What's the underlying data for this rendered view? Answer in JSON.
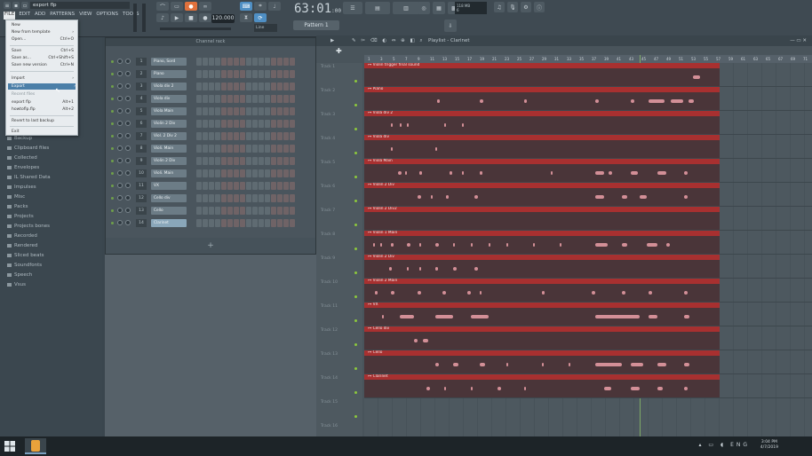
{
  "app": {
    "title_field": "export flp",
    "menu": [
      "FILE",
      "EDIT",
      "ADD",
      "PATTERNS",
      "VIEW",
      "OPTIONS",
      "TOOLS",
      "?"
    ],
    "tempo": "120.000",
    "time": "63:01",
    "time_sub": ":00",
    "pattern": "Pattern 1",
    "cpu_line1": "118 MB",
    "cpu_line2": "6"
  },
  "file_menu": {
    "items": [
      {
        "label": "New",
        "shortcut": ""
      },
      {
        "label": "New from template",
        "shortcut": "›"
      },
      {
        "label": "Open...",
        "shortcut": "Ctrl+O"
      },
      {
        "label": "Save",
        "shortcut": "Ctrl+S"
      },
      {
        "label": "Save as...",
        "shortcut": "Ctrl+Shift+S"
      },
      {
        "label": "Save new version",
        "shortcut": "Ctrl+N"
      },
      {
        "label": "Import",
        "shortcut": "›"
      },
      {
        "label": "Export",
        "shortcut": "›"
      },
      {
        "label": "Recent files",
        "shortcut": ""
      },
      {
        "label": "export flp",
        "shortcut": "Alt+1"
      },
      {
        "label": "howtoflp.flp",
        "shortcut": "Alt+2"
      },
      {
        "label": "Revert to last backup",
        "shortcut": ""
      },
      {
        "label": "Exit",
        "shortcut": ""
      }
    ]
  },
  "browser": {
    "items": [
      "Backup",
      "Clipboard files",
      "Collected",
      "Envelopes",
      "IL Shared Data",
      "Impulses",
      "Misc",
      "Packs",
      "Projects",
      "Projects bones",
      "Recorded",
      "Rendered",
      "Sliced beats",
      "Soundfonts",
      "Speech",
      "Vsus"
    ]
  },
  "channel_rack": {
    "title": "Channel rack",
    "channels": [
      {
        "num": "1",
        "name": "Piano, Sord"
      },
      {
        "num": "2",
        "name": "Piano"
      },
      {
        "num": "3",
        "name": "Viola div 2"
      },
      {
        "num": "4",
        "name": "Viola div"
      },
      {
        "num": "5",
        "name": "Viola Main"
      },
      {
        "num": "6",
        "name": "Violin 2 Div"
      },
      {
        "num": "7",
        "name": "Viol. 2 Div 2"
      },
      {
        "num": "8",
        "name": "Violi. Main"
      },
      {
        "num": "9",
        "name": "Violin 2 Div"
      },
      {
        "num": "10",
        "name": "Violi. Main"
      },
      {
        "num": "11",
        "name": "VX"
      },
      {
        "num": "12",
        "name": "Cello div"
      },
      {
        "num": "13",
        "name": "Cello"
      },
      {
        "num": "14",
        "name": "Clarinet"
      }
    ],
    "add_label": "+"
  },
  "playlist": {
    "title": "Playlist - Clarinet",
    "ruler": [
      "1",
      "3",
      "5",
      "7",
      "9",
      "11",
      "13",
      "15",
      "17",
      "19",
      "21",
      "23",
      "25",
      "27",
      "29",
      "31",
      "33",
      "35",
      "37",
      "39",
      "41",
      "43",
      "45",
      "47",
      "49",
      "51",
      "53",
      "55",
      "57",
      "59",
      "61",
      "63",
      "65",
      "67",
      "69",
      "71"
    ],
    "tracks": [
      "Track 1",
      "Track 2",
      "Track 3",
      "Track 4",
      "Track 5",
      "Track 6",
      "Track 7",
      "Track 8",
      "Track 9",
      "Track 10",
      "Track 11",
      "Track 12",
      "Track 13",
      "Track 14",
      "Track 15",
      "Track 16"
    ],
    "clips": [
      "Violin trigger final sound",
      "Piano",
      "Viola div 2",
      "Viola div",
      "Viola Main",
      "Violin 2 Div",
      "Violin 2 Div2",
      "Violin 1 Main",
      "Violin 2 Div",
      "Violin 2 Main",
      "VX",
      "Cello div",
      "Cello",
      "Clarinet"
    ]
  },
  "taskbar": {
    "clock_time": "3:04 PM",
    "clock_date": "4/7/2019"
  }
}
